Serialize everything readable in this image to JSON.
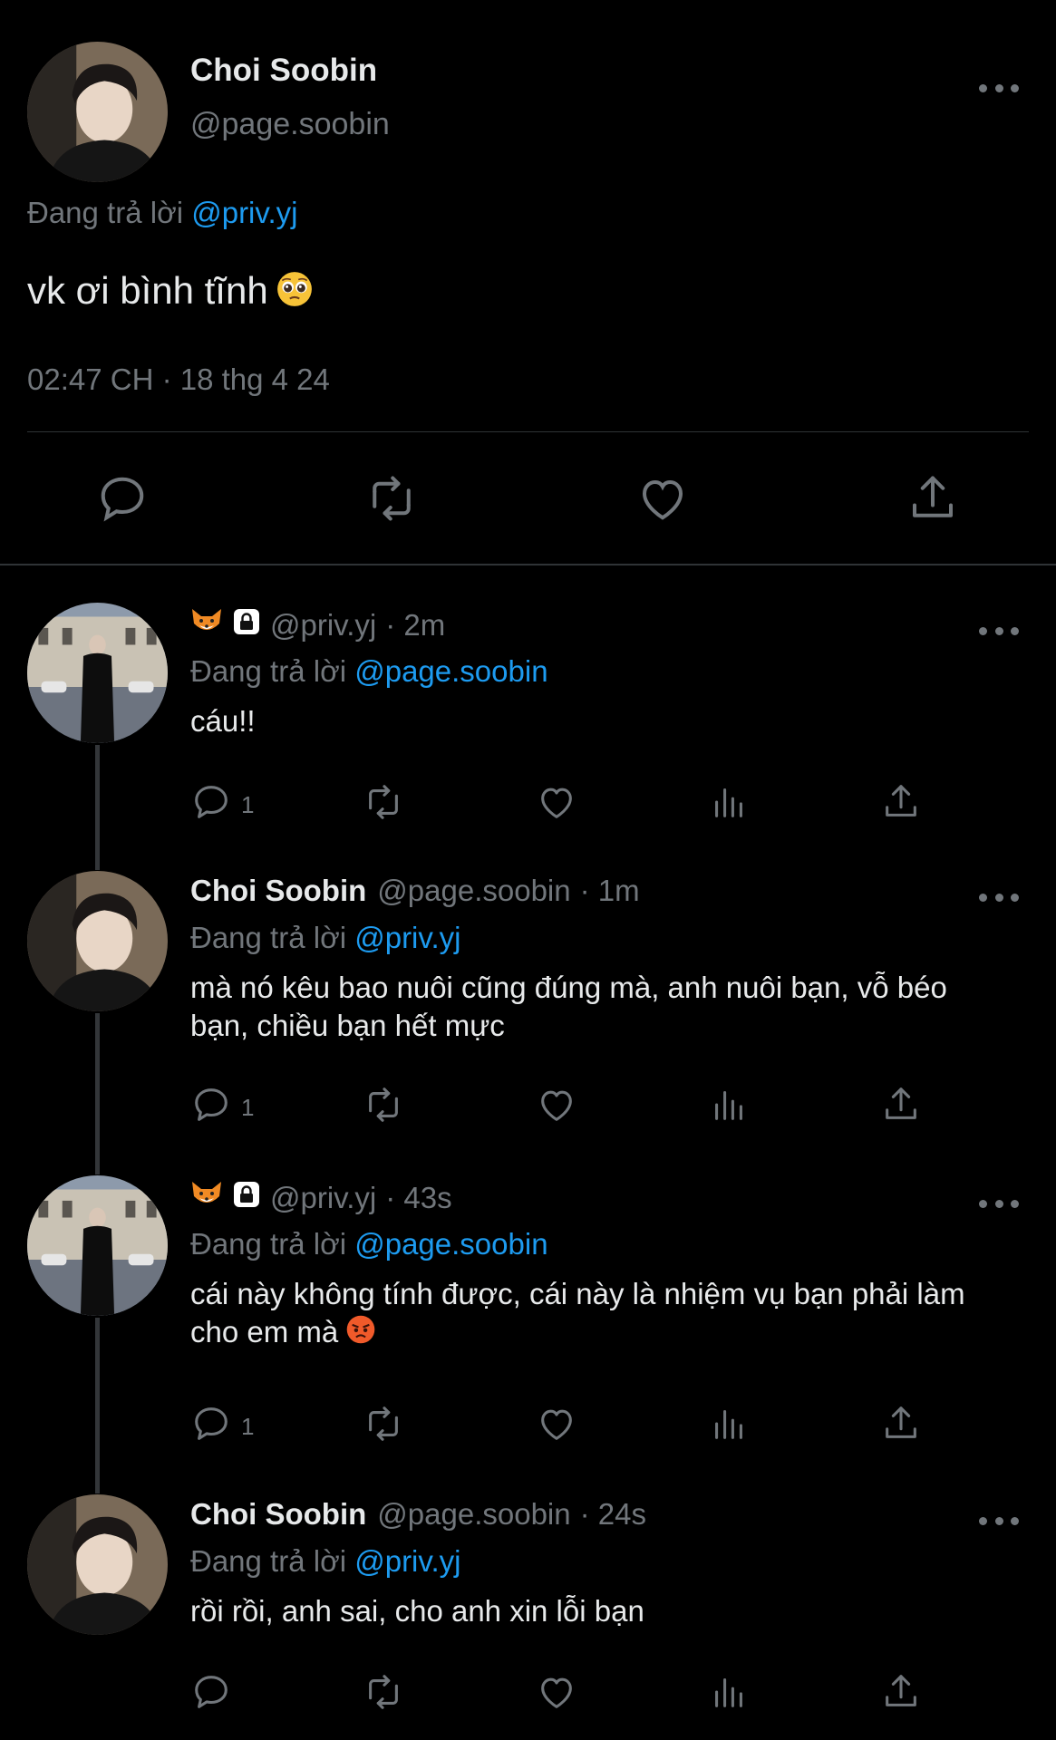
{
  "main_tweet": {
    "name": "Choi Soobin",
    "handle": "@page.soobin",
    "replying_prefix": "Đang trả lời",
    "replying_to": "@priv.yj",
    "text": "vk ơi bình tĩnh",
    "text_emoji": "pleading-face",
    "timestamp": "02:47 CH · 18 thg 4 24"
  },
  "replies": [
    {
      "author": "priv",
      "name": "",
      "name_icons": [
        "fox-icon",
        "lock-icon"
      ],
      "handle": "@priv.yj",
      "time": "· 2m",
      "replying_prefix": "Đang trả lời",
      "replying_to": "@page.soobin",
      "text": "cáu!!",
      "reply_count": "1"
    },
    {
      "author": "soobin",
      "name": "Choi Soobin",
      "handle": "@page.soobin",
      "time": "· 1m",
      "replying_prefix": "Đang trả lời",
      "replying_to": "@priv.yj",
      "text": "mà nó kêu bao nuôi cũng đúng mà, anh nuôi bạn, vỗ béo bạn, chiều bạn hết mực",
      "reply_count": "1"
    },
    {
      "author": "priv",
      "name": "",
      "name_icons": [
        "fox-icon",
        "lock-icon"
      ],
      "handle": "@priv.yj",
      "time": "· 43s",
      "replying_prefix": "Đang trả lời",
      "replying_to": "@page.soobin",
      "text": "cái này không tính được, cái này là nhiệm vụ bạn phải làm cho em mà",
      "text_emoji": "angry-face",
      "reply_count": "1"
    },
    {
      "author": "soobin",
      "name": "Choi Soobin",
      "handle": "@page.soobin",
      "time": "· 24s",
      "replying_prefix": "Đang trả lời",
      "replying_to": "@priv.yj",
      "text": "rồi rồi, anh sai, cho anh xin lỗi bạn",
      "reply_count": ""
    }
  ],
  "colors": {
    "background": "#000000",
    "text": "#e7e9ea",
    "muted": "#71767b",
    "link": "#1d9bf0",
    "divider": "#2f3336"
  }
}
